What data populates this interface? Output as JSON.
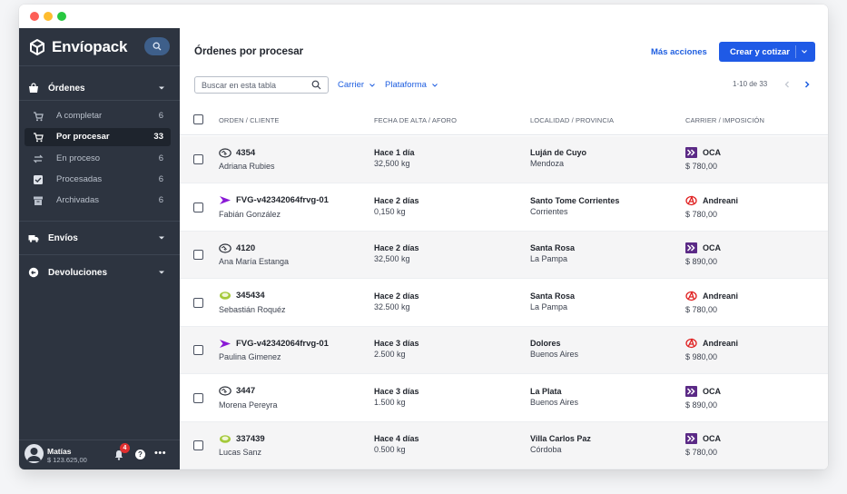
{
  "window": {
    "controls": [
      "close",
      "minimize",
      "maximize"
    ]
  },
  "sidebar": {
    "brand": "Envíopack",
    "sections": {
      "ordenes": {
        "label": "Órdenes",
        "icon": "shopping-bag-icon"
      },
      "envios": {
        "label": "Envíos",
        "icon": "truck-icon"
      },
      "devoluciones": {
        "label": "Devoluciones",
        "icon": "return-icon"
      }
    },
    "items": [
      {
        "label": "A completar",
        "count": "6",
        "icon": "edit-cart-icon",
        "active": false
      },
      {
        "label": "Por procesar",
        "count": "33",
        "icon": "cart-icon",
        "active": true
      },
      {
        "label": "En proceso",
        "count": "6",
        "icon": "sync-icon",
        "active": false
      },
      {
        "label": "Procesadas",
        "count": "6",
        "icon": "check-box-icon",
        "active": false
      },
      {
        "label": "Archivadas",
        "count": "6",
        "icon": "archive-icon",
        "active": false
      }
    ],
    "user": {
      "name": "Matías",
      "balance": "$ 123.625,00",
      "notifications": "4"
    }
  },
  "main": {
    "title": "Órdenes por procesar",
    "more_actions": "Más acciones",
    "primary_action": "Crear y cotizar",
    "search_placeholder": "Buscar en esta tabla",
    "filters": [
      "Carrier",
      "Plataforma"
    ],
    "pagination": "1-10 de 33",
    "columns": [
      "ORDEN / CLIENTE",
      "FECHA DE ALTA / AFORO",
      "LOCALIDAD / PROVINCIA",
      "CARRIER / IMPOSICIÓN"
    ],
    "rows": [
      {
        "order": "4354",
        "platform": "mercadolibre",
        "client": "Adriana Rubies",
        "date": "Hace 1 día",
        "weight": "32,500 kg",
        "city": "Luján de Cuyo",
        "province": "Mendoza",
        "carrier": "OCA",
        "carrier_logo": "oca",
        "price": "$ 780,00"
      },
      {
        "order": "FVG-v42342064frvg-01",
        "platform": "vtex",
        "client": "Fabián González",
        "date": "Hace 2 días",
        "weight": "0,150 kg",
        "city": "Santo Tome Corrientes",
        "province": "Corrientes",
        "carrier": "Andreani",
        "carrier_logo": "andreani",
        "price": "$ 780,00"
      },
      {
        "order": "4120",
        "platform": "mercadolibre",
        "client": "Ana María Estanga",
        "date": "Hace 2 días",
        "weight": "32,500 kg",
        "city": "Santa Rosa",
        "province": "La Pampa",
        "carrier": "OCA",
        "carrier_logo": "oca",
        "price": "$ 890,00"
      },
      {
        "order": "345434",
        "platform": "tiendanube",
        "client": "Sebastián Roquéz",
        "date": "Hace 2 días",
        "weight": "32.500 kg",
        "city": "Santa Rosa",
        "province": "La Pampa",
        "carrier": "Andreani",
        "carrier_logo": "andreani",
        "price": "$ 780,00"
      },
      {
        "order": "FVG-v42342064frvg-01",
        "platform": "vtex",
        "client": "Paulina Gimenez",
        "date": "Hace 3 días",
        "weight": "2.500 kg",
        "city": "Dolores",
        "province": "Buenos Aires",
        "carrier": "Andreani",
        "carrier_logo": "andreani",
        "price": "$ 980,00"
      },
      {
        "order": "3447",
        "platform": "mercadolibre",
        "client": "Morena Pereyra",
        "date": "Hace 3 días",
        "weight": "1.500 kg",
        "city": "La Plata",
        "province": "Buenos Aires",
        "carrier": "OCA",
        "carrier_logo": "oca",
        "price": "$ 890,00"
      },
      {
        "order": "337439",
        "platform": "tiendanube",
        "client": "Lucas Sanz",
        "date": "Hace 4 días",
        "weight": "0.500 kg",
        "city": "Villa Carlos Paz",
        "province": "Córdoba",
        "carrier": "OCA",
        "carrier_logo": "oca",
        "price": "$ 780,00"
      }
    ]
  },
  "colors": {
    "sidebar": "#2d3440",
    "accent": "#1f5ae6",
    "oca": "#5b2a86",
    "andreani": "#e02020",
    "vtex": "#8a1ad6",
    "tiendanube_green": "#a4c93a"
  }
}
